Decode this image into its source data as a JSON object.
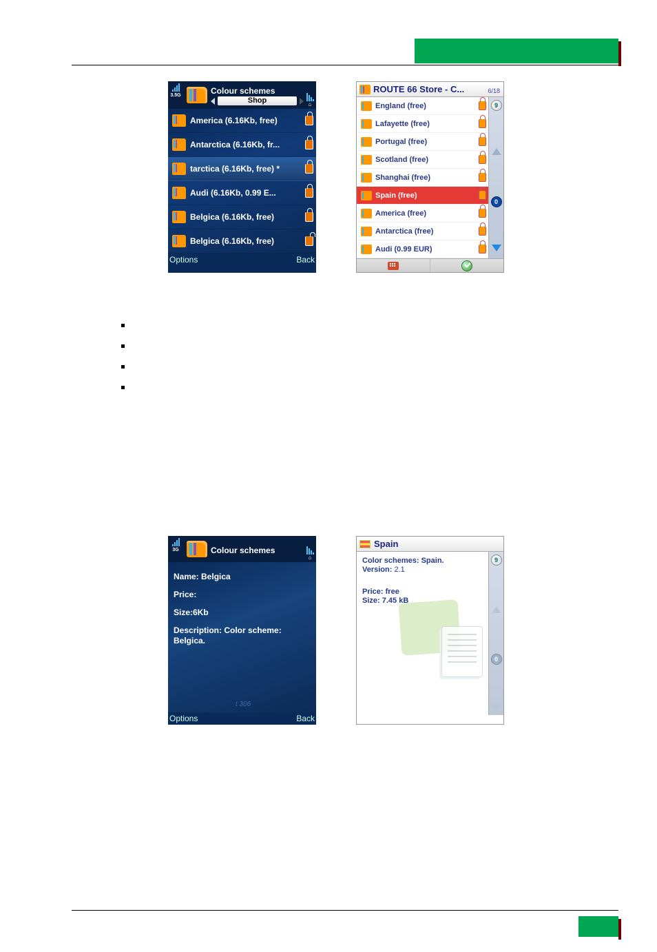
{
  "accent_green": "#00a651",
  "dark": {
    "top": {
      "title": "Colour schemes",
      "network_label": "3.5G",
      "shop_label": "Shop",
      "clock_symbol": "⌂"
    },
    "list": [
      {
        "text": "America (6.16Kb, free)",
        "selected": false,
        "open": false
      },
      {
        "text": "Antarctica (6.16Kb, fr...",
        "selected": false,
        "open": false
      },
      {
        "text": "tarctica (6.16Kb, free) *",
        "selected": true,
        "open": false
      },
      {
        "text": "Audi (6.16Kb, 0.99 E...",
        "selected": false,
        "open": false
      },
      {
        "text": "Belgica (6.16Kb, free)",
        "selected": false,
        "open": false
      },
      {
        "text": "Belgica (6.16Kb, free)",
        "selected": false,
        "open": true
      }
    ],
    "softkeys": {
      "left": "Options",
      "right": "Back"
    }
  },
  "light": {
    "title": "ROUTE 66 Store - C...",
    "counter": "6/18",
    "list": [
      {
        "text": "England  (free)",
        "selected": false
      },
      {
        "text": "Lafayette  (free)",
        "selected": false
      },
      {
        "text": "Portugal  (free)",
        "selected": false
      },
      {
        "text": "Scotland  (free)",
        "selected": false
      },
      {
        "text": "Shanghai  (free)",
        "selected": false
      },
      {
        "text": "Spain (free)",
        "selected": true
      },
      {
        "text": "America  (free)",
        "selected": false
      },
      {
        "text": "Antarctica  (free)",
        "selected": false
      },
      {
        "text": "Audi (0.99 EUR)",
        "selected": false
      }
    ],
    "side": {
      "top_badge": "9",
      "mid_badge": "0"
    }
  },
  "dark_detail": {
    "title": "Colour schemes",
    "network_label": "3G",
    "name_label": "Name: Belgica",
    "price_label": "Price:",
    "size_label": "Size:6Kb",
    "desc_line1": "Description: Color scheme:",
    "desc_line2": "Belgica.",
    "bgnum": "t 306",
    "softkeys": {
      "left": "Options",
      "right": "Back"
    }
  },
  "light_detail": {
    "title": "Spain",
    "line1": "Color schemes: Spain.",
    "line2_label": "Version:",
    "line2_val": " 2.1",
    "line3": "Price: free",
    "line4": "Size: 7.45 kB",
    "side_top_badge": "9",
    "side_mid_badge": "0"
  }
}
